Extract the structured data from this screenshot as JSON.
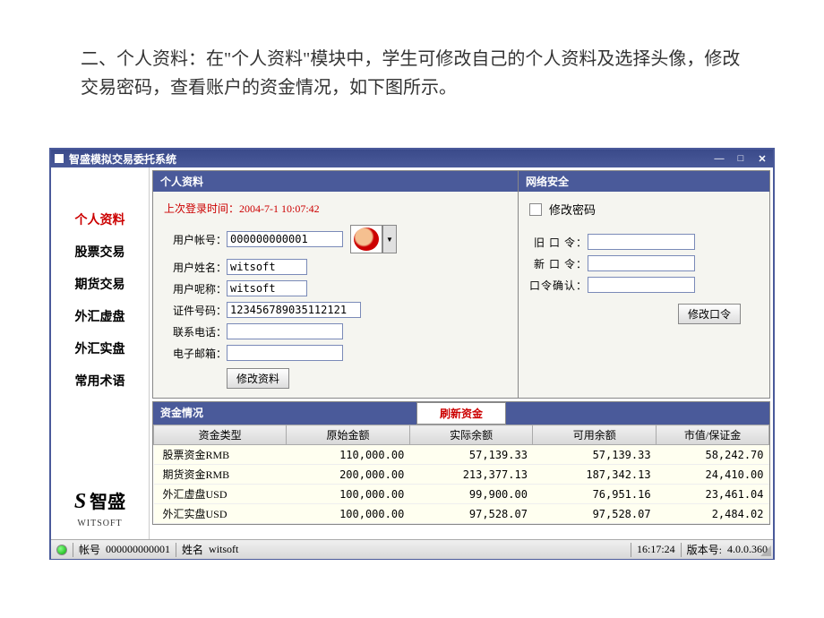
{
  "intro": "二、个人资料：在\"个人资料\"模块中，学生可修改自己的个人资料及选择头像，修改交易密码，查看账户的资金情况，如下图所示。",
  "window": {
    "title": "智盛模拟交易委托系统"
  },
  "sidebar": {
    "items": [
      {
        "label": "个人资料",
        "active": true
      },
      {
        "label": "股票交易",
        "active": false
      },
      {
        "label": "期货交易",
        "active": false
      },
      {
        "label": "外汇虚盘",
        "active": false
      },
      {
        "label": "外汇实盘",
        "active": false
      },
      {
        "label": "常用术语",
        "active": false
      }
    ],
    "logo": {
      "brand_cn": "智盛",
      "brand_en": "WITSOFT"
    }
  },
  "profile": {
    "panel_title": "个人资料",
    "login_time_label": "上次登录时间：",
    "login_time_value": "2004-7-1 10:07:42",
    "fields": {
      "account_label": "用户帐号：",
      "account_value": "000000000001",
      "name_label": "用户姓名：",
      "name_value": "witsoft",
      "nick_label": "用户呢称：",
      "nick_value": "witsoft",
      "id_label": "证件号码：",
      "id_value": "123456789035112121",
      "phone_label": "联系电话：",
      "phone_value": "",
      "email_label": "电子邮箱：",
      "email_value": ""
    },
    "modify_button": "修改资料"
  },
  "security": {
    "panel_title": "网络安全",
    "checkbox_label": "修改密码",
    "old_label": "旧 口 令：",
    "new_label": "新 口 令：",
    "confirm_label": "口令确认：",
    "button": "修改口令"
  },
  "funds": {
    "panel_title": "资金情况",
    "refresh_button": "刷新资金",
    "columns": [
      "资金类型",
      "原始金额",
      "实际余额",
      "可用余额",
      "市值/保证金"
    ],
    "rows": [
      {
        "type": "股票资金RMB",
        "orig": "110,000.00",
        "actual": "57,139.33",
        "avail": "57,139.33",
        "mv": "58,242.70"
      },
      {
        "type": "期货资金RMB",
        "orig": "200,000.00",
        "actual": "213,377.13",
        "avail": "187,342.13",
        "mv": "24,410.00"
      },
      {
        "type": "外汇虚盘USD",
        "orig": "100,000.00",
        "actual": "99,900.00",
        "avail": "76,951.16",
        "mv": "23,461.04"
      },
      {
        "type": "外汇实盘USD",
        "orig": "100,000.00",
        "actual": "97,528.07",
        "avail": "97,528.07",
        "mv": "2,484.02"
      }
    ]
  },
  "statusbar": {
    "account_label": "帐号",
    "account_value": "000000000001",
    "name_label": "姓名",
    "name_value": "witsoft",
    "time": "16:17:24",
    "version_label": "版本号:",
    "version_value": "4.0.0.360"
  }
}
